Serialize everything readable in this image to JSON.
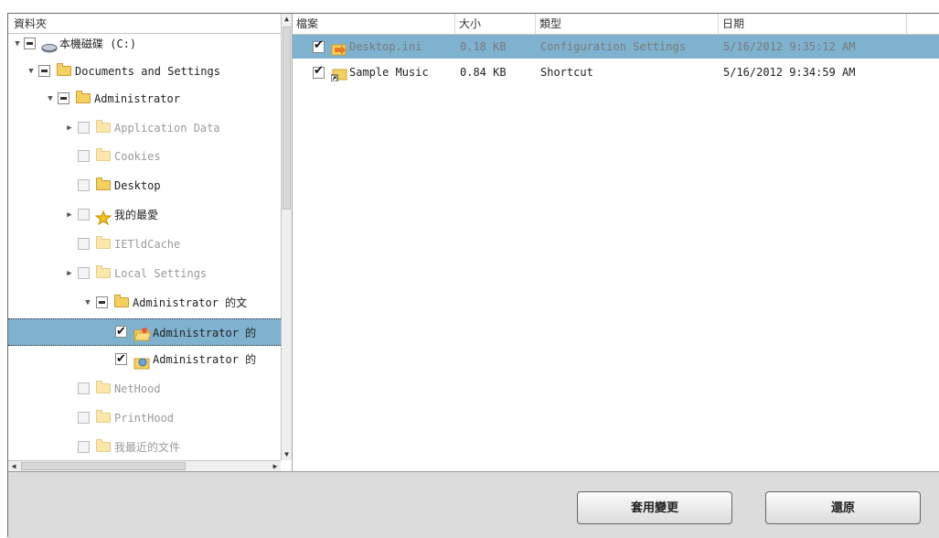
{
  "tree": {
    "header": "資料夾",
    "rows": [
      {
        "label": "本機磁碟 (C:)",
        "icon": "drive-icon"
      },
      {
        "label": "Documents and Settings",
        "icon": "folder-icon"
      },
      {
        "label": "Administrator",
        "icon": "folder-icon"
      },
      {
        "label": "Application Data",
        "icon": "folder-icon"
      },
      {
        "label": "Cookies",
        "icon": "folder-icon"
      },
      {
        "label": "Desktop",
        "icon": "folder-icon"
      },
      {
        "label": "我的最愛",
        "icon": "star-icon"
      },
      {
        "label": "IETldCache",
        "icon": "folder-icon"
      },
      {
        "label": "Local Settings",
        "icon": "folder-icon"
      },
      {
        "label": "Administrator 的文",
        "icon": "folder-icon"
      },
      {
        "label": "Administrator 的",
        "icon": "open-folder-icon"
      },
      {
        "label": "Administrator 的",
        "icon": "music-folder-icon"
      },
      {
        "label": "NetHood",
        "icon": "folder-icon"
      },
      {
        "label": "PrintHood",
        "icon": "folder-icon"
      },
      {
        "label": "我最近的文件",
        "icon": "folder-icon"
      }
    ]
  },
  "files": {
    "columns": [
      "檔案",
      "大小",
      "類型",
      "日期"
    ],
    "rows": [
      {
        "name": "Desktop.ini",
        "size": "0.18 KB",
        "type": "Configuration Settings",
        "date": "5/16/2012 9:35:12 AM"
      },
      {
        "name": "Sample Music",
        "size": "0.84 KB",
        "type": "Shortcut",
        "date": "5/16/2012 9:34:59 AM"
      }
    ]
  },
  "buttons": {
    "apply": "套用變更",
    "restore": "還原"
  },
  "colors": {
    "selection": "#7eb2cf",
    "folder": "#f5cf60"
  }
}
